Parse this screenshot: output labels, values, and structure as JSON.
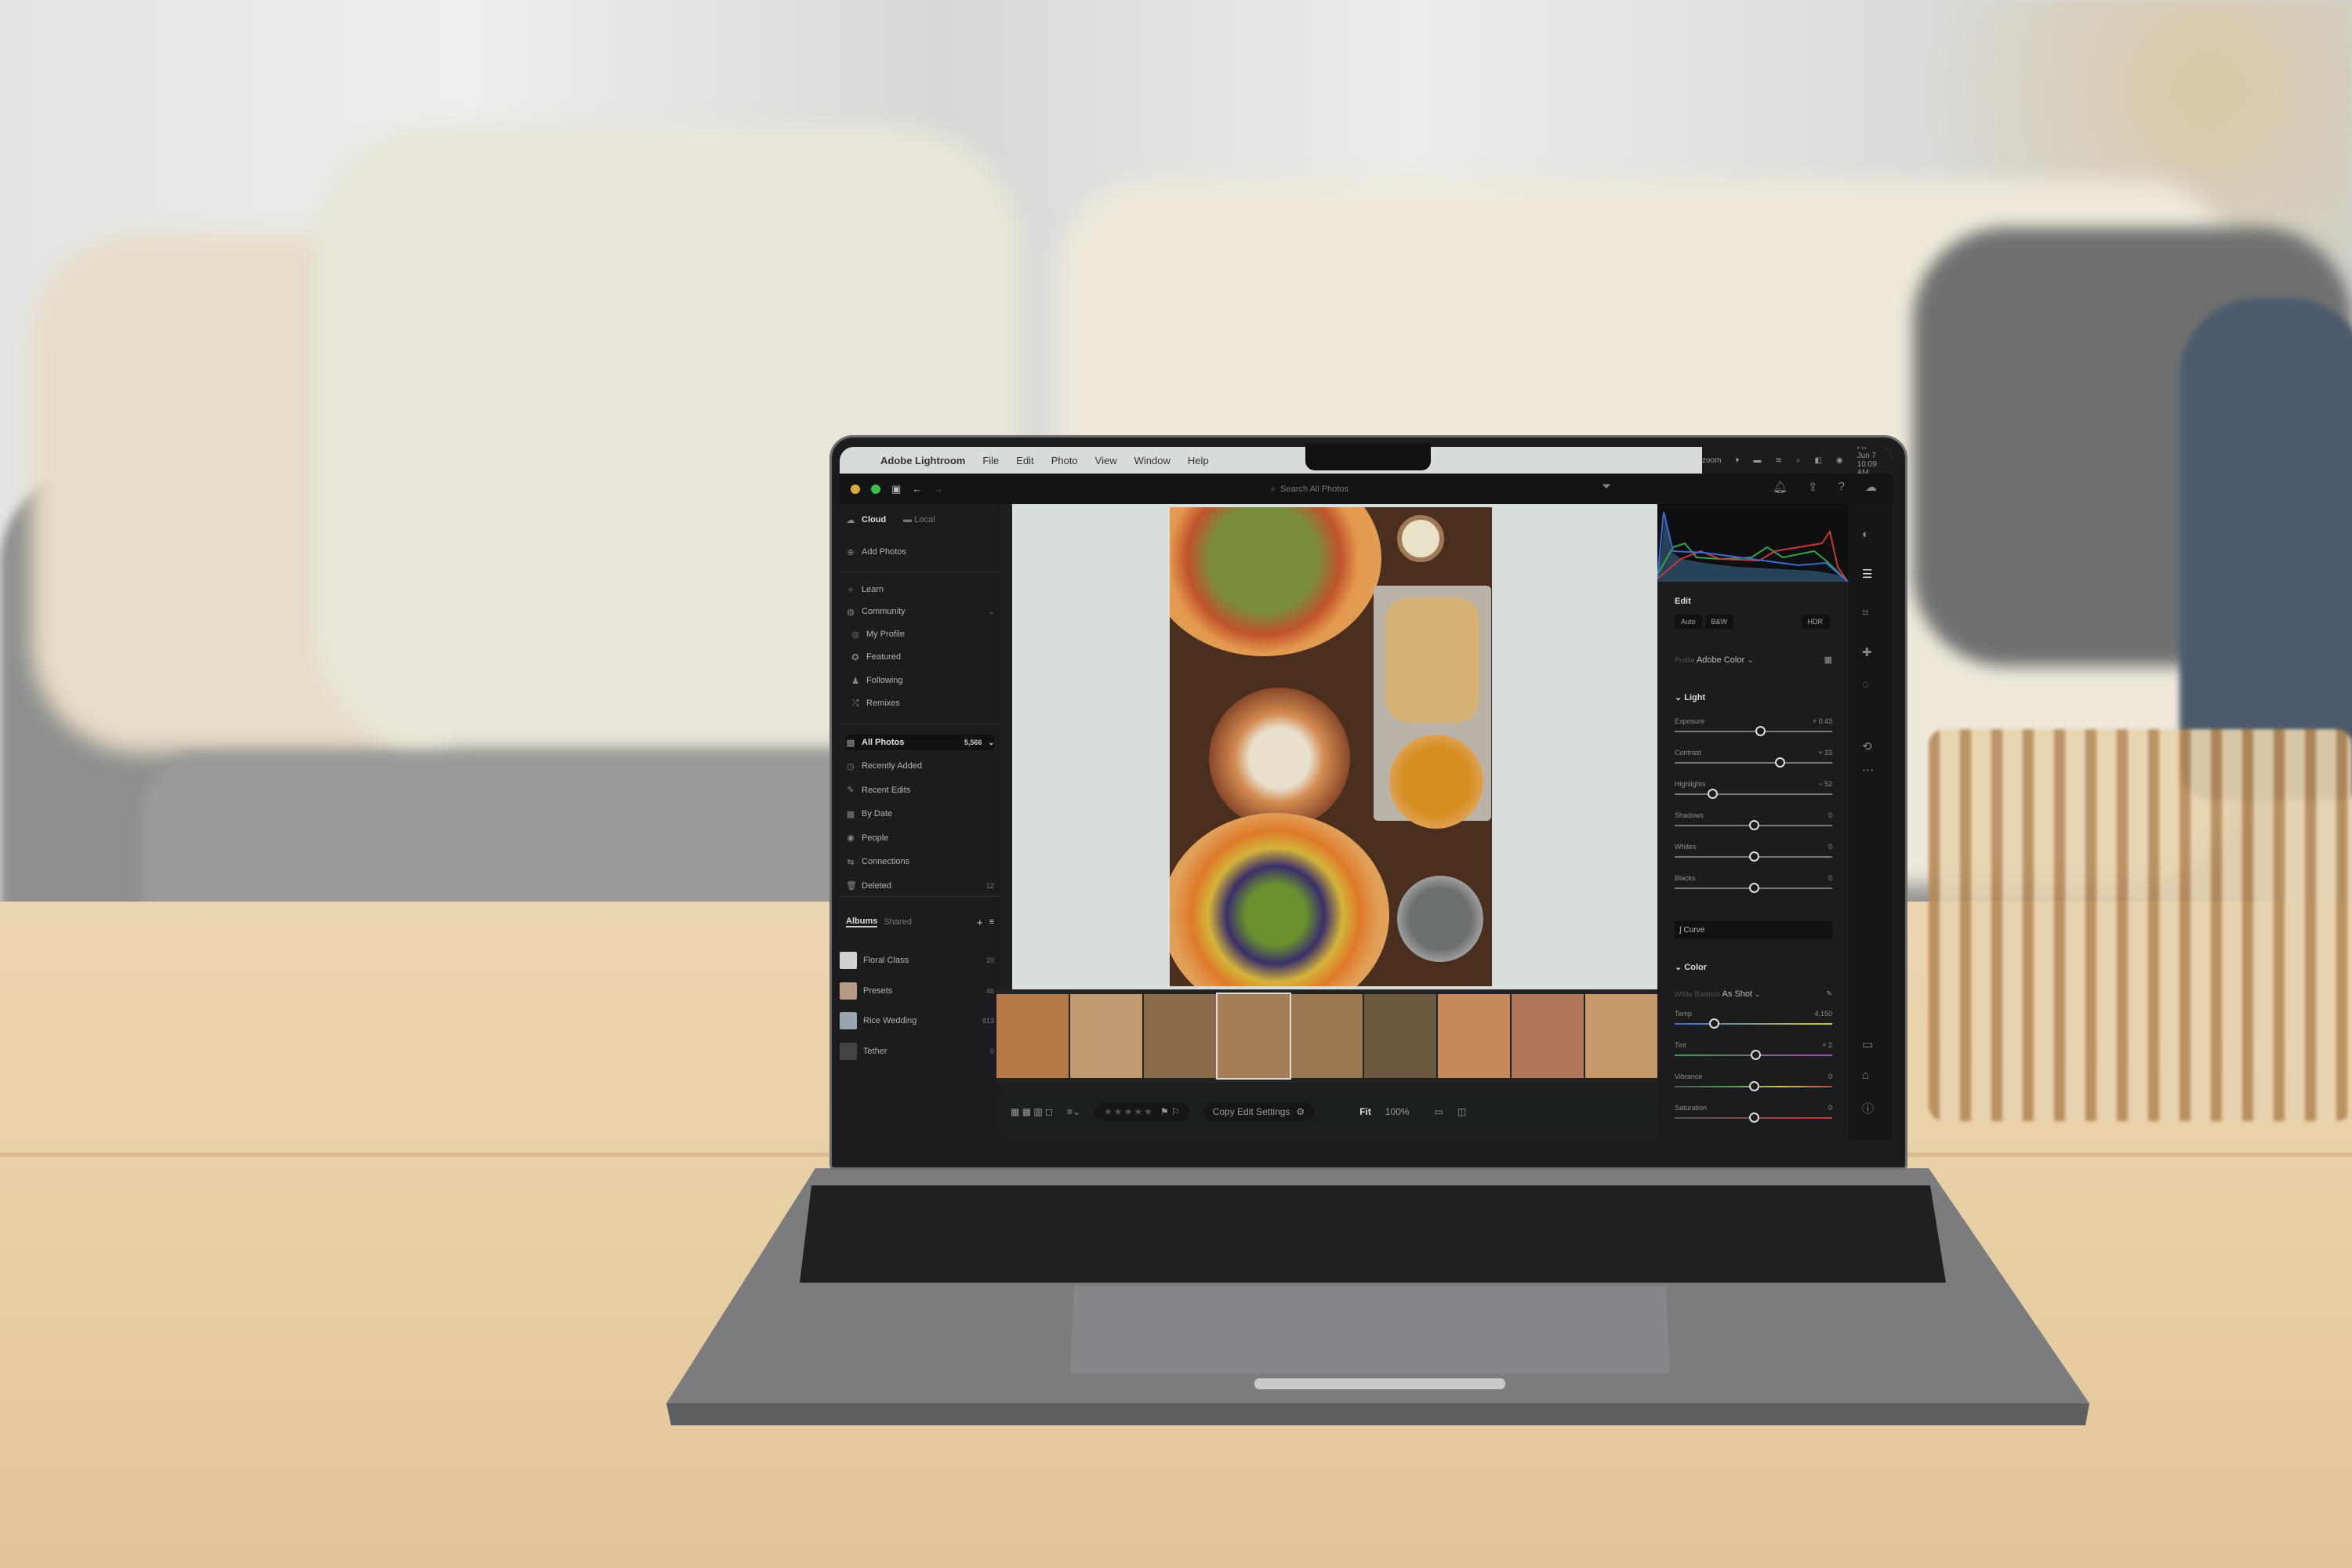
{
  "menubar": {
    "app": "Adobe Lightroom",
    "menus": [
      "File",
      "Edit",
      "Photo",
      "View",
      "Window",
      "Help"
    ],
    "status": {
      "zoom": "zoom",
      "datetime": "Fri Jun 7  10:09 AM"
    }
  },
  "toolbar": {
    "search_placeholder": "Search All Photos"
  },
  "left": {
    "tabs": {
      "cloud": "Cloud",
      "local": "Local"
    },
    "add_photos": "Add Photos",
    "learn": "Learn",
    "community": {
      "label": "Community",
      "items": [
        "My Profile",
        "Featured",
        "Following",
        "Remixes"
      ]
    },
    "all_photos": {
      "label": "All Photos",
      "count": "5,566"
    },
    "library": [
      {
        "label": "Recently Added",
        "icon": "clock-icon"
      },
      {
        "label": "Recent Edits",
        "icon": "edit-icon"
      },
      {
        "label": "By Date",
        "icon": "calendar-icon"
      },
      {
        "label": "People",
        "icon": "person-icon"
      },
      {
        "label": "Connections",
        "icon": "swap-icon"
      },
      {
        "label": "Deleted",
        "icon": "trash-icon",
        "count": "12"
      }
    ],
    "album_tabs": {
      "albums": "Albums",
      "shared": "Shared"
    },
    "albums": [
      {
        "label": "Floral Class",
        "count": "20"
      },
      {
        "label": "Presets",
        "count": "46"
      },
      {
        "label": "Rice Wedding",
        "count": "813"
      },
      {
        "label": "Tether",
        "count": "0"
      }
    ]
  },
  "bottom": {
    "copy_edit": "Copy Edit Settings",
    "fit": "Fit",
    "zoom": "100%",
    "stars": "★★★★★"
  },
  "edit": {
    "title": "Edit",
    "buttons": [
      "Auto",
      "B&W",
      "HDR"
    ],
    "profile_label": "Profile",
    "profile_value": "Adobe Color",
    "light": {
      "title": "Light",
      "sliders": [
        {
          "label": "Exposure",
          "value": "+ 0.43",
          "num": 0.43
        },
        {
          "label": "Contrast",
          "value": "+ 33",
          "num": 33
        },
        {
          "label": "Highlights",
          "value": "− 52",
          "num": -52
        },
        {
          "label": "Shadows",
          "value": "0",
          "num": 0
        },
        {
          "label": "Whites",
          "value": "0",
          "num": 0
        },
        {
          "label": "Blacks",
          "value": "0",
          "num": 0
        }
      ]
    },
    "curve": "Curve",
    "color": {
      "title": "Color",
      "wb_label": "White Balance",
      "wb_value": "As Shot",
      "sliders": [
        {
          "label": "Temp",
          "value": "4,150",
          "num": 4150
        },
        {
          "label": "Tint",
          "value": "+ 2",
          "num": 2
        },
        {
          "label": "Vibrance",
          "value": "0",
          "num": 0
        },
        {
          "label": "Saturation",
          "value": "0",
          "num": 0
        }
      ]
    }
  },
  "colors": {
    "accent": "#1473e6",
    "ui_bg": "#1a1c1d",
    "loupe_bg": "#d8dedb"
  }
}
